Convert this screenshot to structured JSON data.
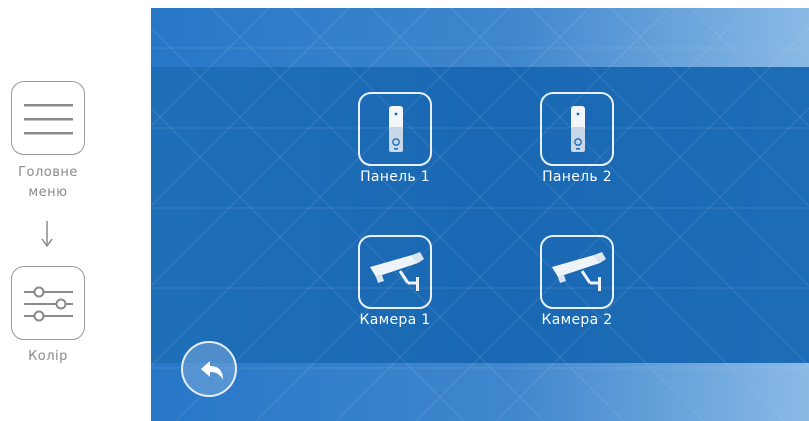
{
  "instructions": {
    "step1_label_line1": "Головне",
    "step1_label_line2": "меню",
    "step1_icon": "hamburger-menu-icon",
    "arrow_icon": "arrow-down-icon",
    "step2_label": "Колір",
    "step2_icon": "sliders-icon"
  },
  "screen": {
    "tiles": [
      {
        "label": "Панель 1",
        "icon": "door-panel-icon"
      },
      {
        "label": "Панель 2",
        "icon": "door-panel-icon"
      },
      {
        "label": "Камера 1",
        "icon": "cctv-camera-icon"
      },
      {
        "label": "Камера 2",
        "icon": "cctv-camera-icon"
      }
    ],
    "back_icon": "back-arrow-icon",
    "colors": {
      "screen_blue": "#1a69b4",
      "tile_border": "#e8f0f8",
      "label_white": "#ffffff"
    }
  }
}
